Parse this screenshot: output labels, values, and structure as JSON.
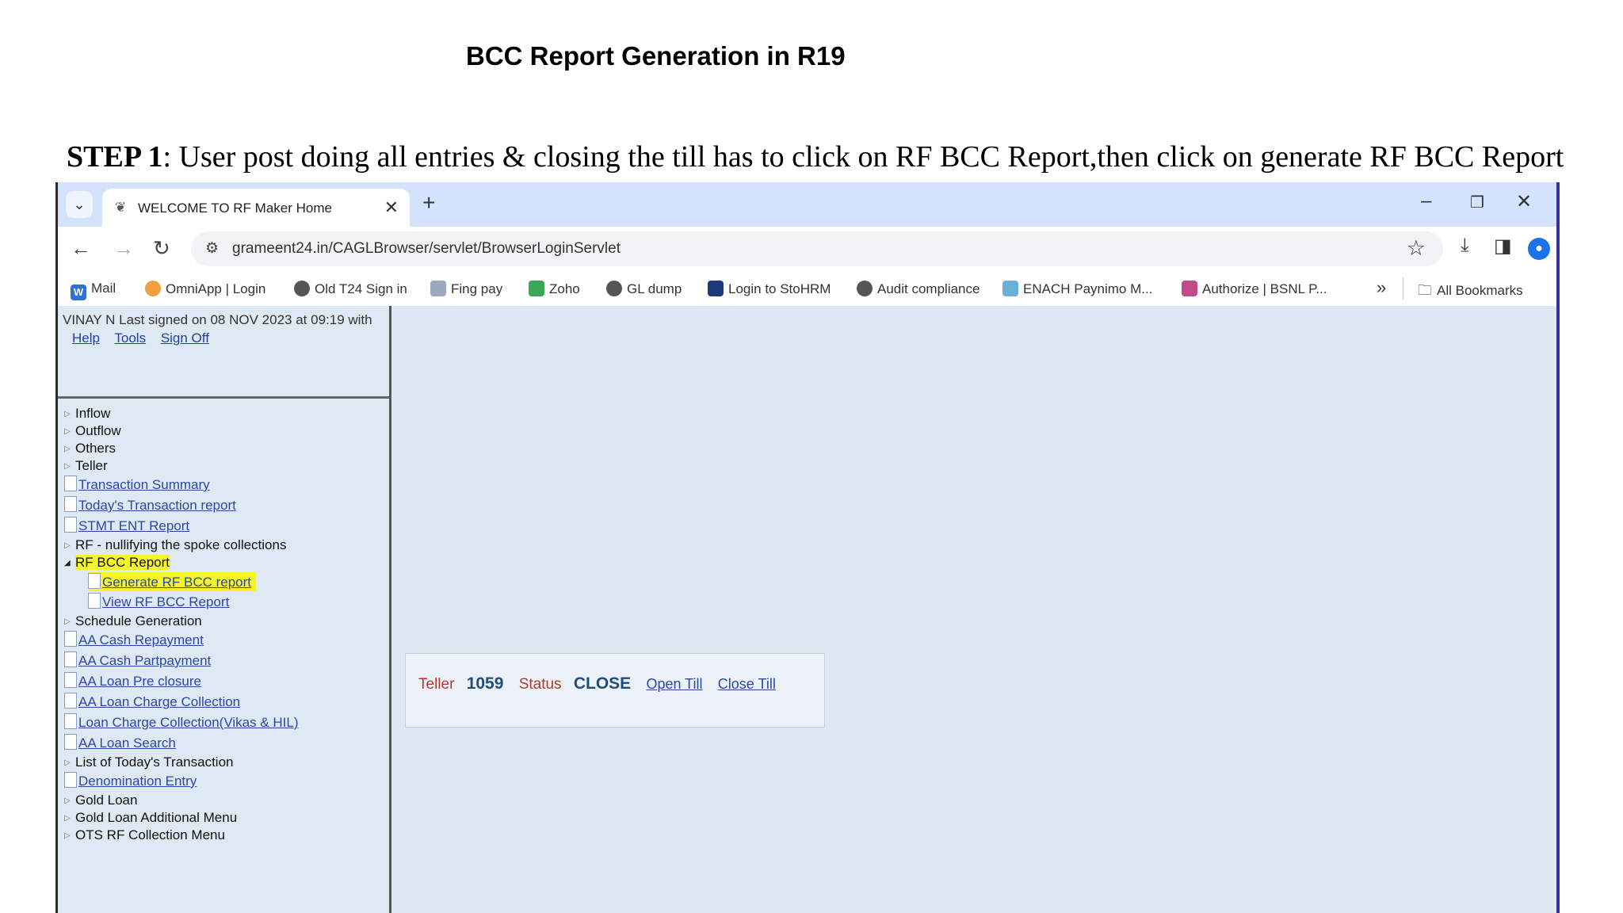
{
  "document": {
    "title": "BCC Report Generation in R19",
    "step_label": "STEP 1",
    "step_text": ": User post doing all entries & closing the till has to click on RF BCC Report,then click on generate RF BCC Report"
  },
  "browser": {
    "tab_title": "WELCOME TO RF Maker Home",
    "url": "grameent24.in/CAGLBrowser/servlet/BrowserLoginServlet",
    "bookmarks": [
      "Mail",
      "OmniApp | Login",
      "Old T24 Sign in",
      "Fing pay",
      "Zoho",
      "GL dump",
      "Login to StoHRM",
      "Audit compliance",
      "ENACH Paynimo M...",
      "Authorize | BSNL P..."
    ],
    "more_bookmarks": "»",
    "all_bookmarks": "All Bookmarks"
  },
  "app": {
    "user_line": "VINAY N Last signed on 08 NOV 2023 at 09:19 with",
    "links": [
      "Help",
      "Tools",
      "Sign Off"
    ],
    "menu": [
      "Inflow",
      "Outflow",
      "Others",
      "Teller",
      "Transaction Summary",
      "Today's Transaction report",
      "STMT ENT Report",
      "RF - nullifying the spoke collections",
      "RF BCC Report",
      "Generate RF BCC report",
      "View RF BCC Report",
      "Schedule Generation",
      "AA Cash Repayment",
      "AA Cash Partpayment",
      "AA Loan Pre closure",
      "AA Loan Charge Collection",
      "Loan Charge Collection(Vikas & HIL)",
      "AA Loan Search",
      "List of Today's Transaction",
      "Denomination Entry",
      "Gold Loan",
      "Gold Loan Additional Menu",
      "OTS RF Collection Menu"
    ],
    "till": {
      "teller_label": "Teller",
      "teller_value": "1059",
      "status_label": "Status",
      "status_value": "CLOSE",
      "open_link": "Open Till",
      "close_link": "Close Till"
    }
  },
  "colors": {
    "highlight": "#f5f52a",
    "link": "#2a47a8",
    "pane_bg": "#dfe9f3",
    "tabstrip_bg": "#d3e3fd"
  }
}
